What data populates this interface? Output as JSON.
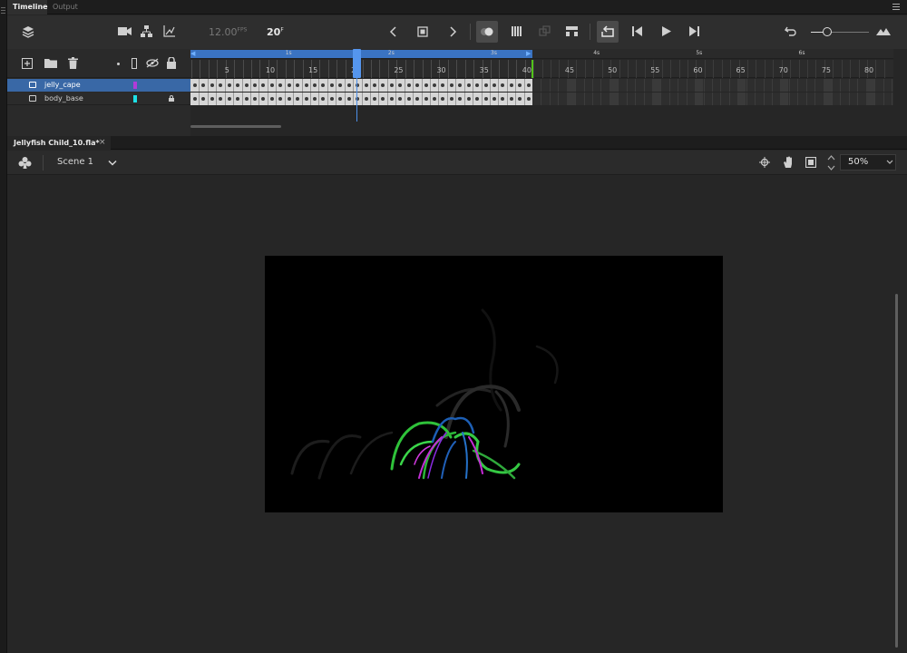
{
  "panel_tabs": {
    "timeline": "Timeline",
    "output": "Output"
  },
  "toolbar": {
    "fps_value": "12.00",
    "fps_unit": "FPS",
    "current_frame": "20",
    "frame_unit": "F"
  },
  "layers": [
    {
      "name": "jelly_cape",
      "color": "#b23ad9",
      "selected": true,
      "locked": false
    },
    {
      "name": "body_base",
      "color": "#1ee0e6",
      "selected": false,
      "locked": true
    }
  ],
  "timeline": {
    "frame_labels": [
      "5",
      "10",
      "15",
      "20",
      "25",
      "30",
      "35",
      "40",
      "45",
      "50",
      "55",
      "60",
      "65",
      "70",
      "75",
      "80"
    ],
    "second_labels": [
      "1s",
      "2s",
      "3s",
      "4s",
      "5s",
      "6s"
    ],
    "playhead_frame": 20,
    "last_frame": 40
  },
  "document": {
    "tab_title": "Jellyfish Child_10.fla*"
  },
  "stage_header": {
    "scene": "Scene 1",
    "zoom": "50%"
  },
  "colors": {
    "accent": "#3968a6",
    "range": "#3a73c2",
    "end_marker": "#52c41a"
  }
}
